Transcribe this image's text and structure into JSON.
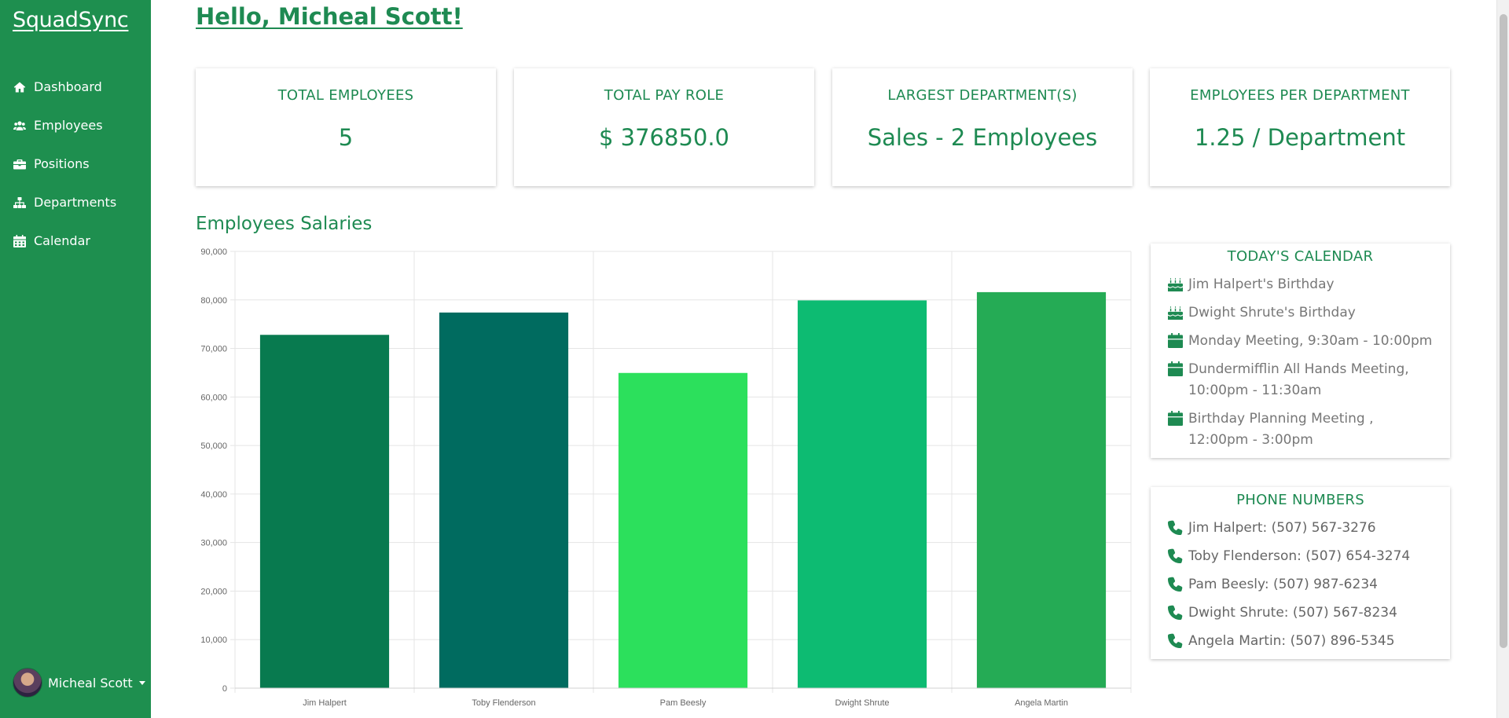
{
  "app": {
    "brand": "SquadSync"
  },
  "sidebar": {
    "items": [
      {
        "label": "Dashboard",
        "icon": "home-icon"
      },
      {
        "label": "Employees",
        "icon": "users-icon"
      },
      {
        "label": "Positions",
        "icon": "briefcase-icon"
      },
      {
        "label": "Departments",
        "icon": "sitemap-icon"
      },
      {
        "label": "Calendar",
        "icon": "calendar-icon"
      }
    ],
    "user": {
      "name": "Micheal Scott"
    }
  },
  "header": {
    "greeting": "Hello, Micheal Scott!"
  },
  "stats": [
    {
      "label": "TOTAL EMPLOYEES",
      "value": "5"
    },
    {
      "label": "TOTAL PAY ROLE",
      "value": "$ 376850.0"
    },
    {
      "label": "LARGEST DEPARTMENT(S)",
      "value": "Sales - 2 Employees"
    },
    {
      "label": "EMPLOYEES PER DEPARTMENT",
      "value": "1.25 / Department"
    }
  ],
  "chart_title": "Employees Salaries",
  "chart_data": {
    "type": "bar",
    "categories": [
      "Jim Halpert",
      "Toby Flenderson",
      "Pam Beesly",
      "Dwight Shrute",
      "Angela Martin"
    ],
    "values": [
      72800,
      77400,
      64950,
      79900,
      81600
    ],
    "colors": [
      "#087a4f",
      "#006b5f",
      "#2ce05c",
      "#0dbb72",
      "#25ab55"
    ],
    "ylim": [
      0,
      90000
    ],
    "yticks": [
      "0",
      "10,000",
      "20,000",
      "30,000",
      "40,000",
      "50,000",
      "60,000",
      "70,000",
      "80,000",
      "90,000"
    ],
    "grid": true
  },
  "calendar": {
    "title": "TODAY'S CALENDAR",
    "items": [
      {
        "icon": "birthday-cake-icon",
        "text": "Jim Halpert's Birthday"
      },
      {
        "icon": "birthday-cake-icon",
        "text": "Dwight Shrute's Birthday"
      },
      {
        "icon": "calendar-icon",
        "text": "Monday Meeting, 9:30am - 10:00pm"
      },
      {
        "icon": "calendar-icon",
        "text": "Dundermifflin All Hands Meeting, 10:00pm - 11:30am"
      },
      {
        "icon": "calendar-icon",
        "text": "Birthday Planning Meeting , 12:00pm - 3:00pm"
      }
    ]
  },
  "phones": {
    "title": "PHONE NUMBERS",
    "items": [
      {
        "icon": "phone-icon",
        "text": "Jim Halpert: (507) 567-3276"
      },
      {
        "icon": "phone-icon",
        "text": "Toby Flenderson: (507) 654-3274"
      },
      {
        "icon": "phone-icon",
        "text": "Pam Beesly: (507) 987-6234"
      },
      {
        "icon": "phone-icon",
        "text": "Dwight Shrute: (507) 567-8234"
      },
      {
        "icon": "phone-icon",
        "text": "Angela Martin: (507) 896-5345"
      }
    ]
  }
}
